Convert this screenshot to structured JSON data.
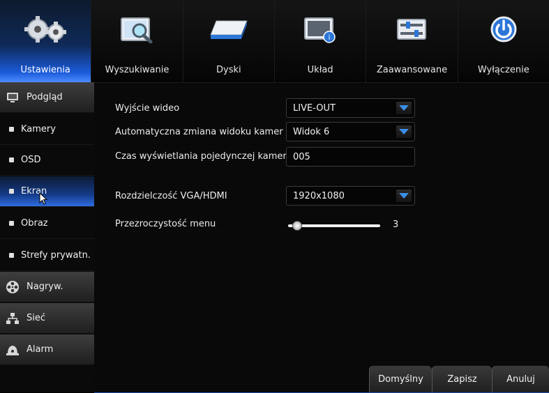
{
  "top_tabs": [
    {
      "label": "Ustawienia",
      "icon": "gears-icon",
      "active": true
    },
    {
      "label": "Wyszukiwanie",
      "icon": "search-document-icon",
      "active": false
    },
    {
      "label": "Dyski",
      "icon": "hard-disk-icon",
      "active": false
    },
    {
      "label": "Układ",
      "icon": "system-info-icon",
      "active": false
    },
    {
      "label": "Zaawansowane",
      "icon": "advanced-sliders-icon",
      "active": false
    },
    {
      "label": "Wyłączenie",
      "icon": "power-icon",
      "active": false
    }
  ],
  "sidebar": {
    "items": [
      {
        "label": "Podgląd",
        "type": "group",
        "icon": "monitor-icon"
      },
      {
        "label": "Kamery",
        "type": "item"
      },
      {
        "label": "OSD",
        "type": "item"
      },
      {
        "label": "Ekran",
        "type": "item",
        "active": true
      },
      {
        "label": "Obraz",
        "type": "item"
      },
      {
        "label": "Strefy prywatn.",
        "type": "item"
      },
      {
        "label": "Nagryw.",
        "type": "group",
        "icon": "film-reel-icon"
      },
      {
        "label": "Sieć",
        "type": "group",
        "icon": "network-icon"
      },
      {
        "label": "Alarm",
        "type": "group",
        "icon": "alarm-bell-icon"
      }
    ]
  },
  "settings": {
    "video_output": {
      "label": "Wyjście wideo",
      "value": "LIVE-OUT"
    },
    "auto_switch": {
      "label": "Automatyczna zmiana widoku kamer",
      "value": "Widok 6"
    },
    "dwell_time": {
      "label": "Czas wyświetlania pojedynczej kamery",
      "value": "005"
    },
    "resolution": {
      "label": "Rozdzielczość VGA/HDMI",
      "value": "1920x1080"
    },
    "transparency": {
      "label": "Przezroczystość menu",
      "value": "3",
      "fraction": 0.05
    }
  },
  "buttons": {
    "default": "Domyślny",
    "save": "Zapisz",
    "cancel": "Anuluj"
  },
  "colors": {
    "accent": "#2e6de0",
    "dropdown_arrow": "#3a8fe8"
  }
}
